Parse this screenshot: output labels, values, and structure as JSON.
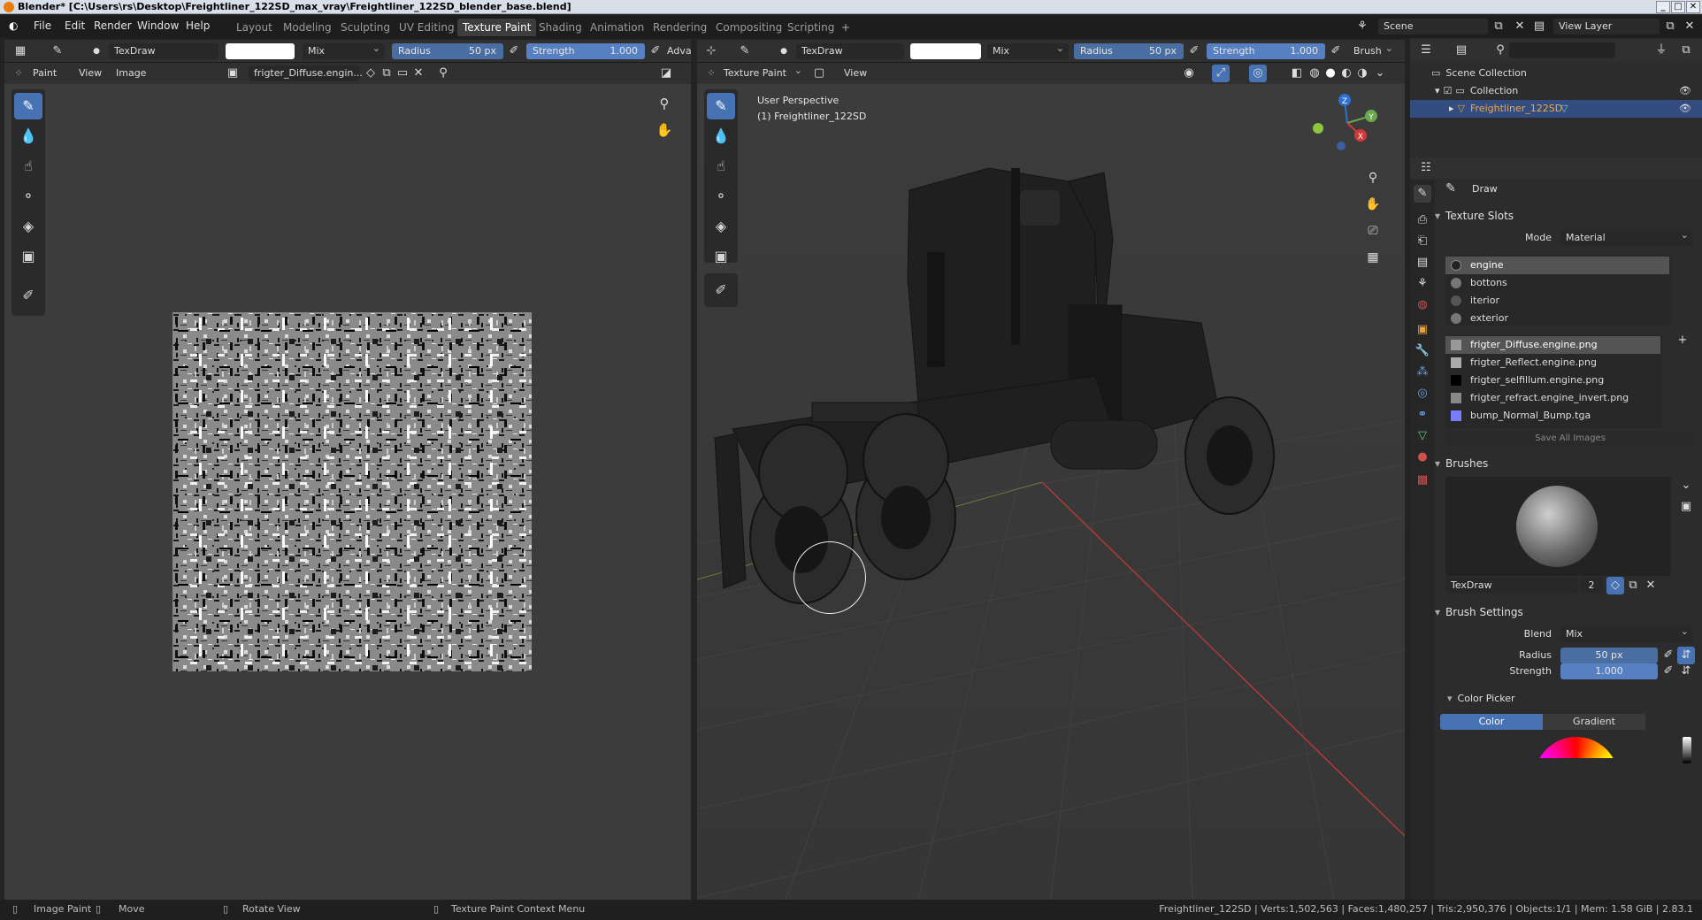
{
  "title": "Blender* [C:\\Users\\rs\\Desktop\\Freightliner_122SD_max_vray\\Freightliner_122SD_blender_base.blend]",
  "menu": [
    "File",
    "Edit",
    "Render",
    "Window",
    "Help"
  ],
  "workspaces": [
    "Layout",
    "Modeling",
    "Sculpting",
    "UV Editing",
    "Texture Paint",
    "Shading",
    "Animation",
    "Rendering",
    "Compositing",
    "Scripting"
  ],
  "active_workspace": "Texture Paint",
  "scene": "Scene",
  "view_layer": "View Layer",
  "left_header": {
    "brush": "TexDraw",
    "blend": "Mix",
    "radius_label": "Radius",
    "radius_value": "50 px",
    "strength_label": "Strength",
    "strength_value": "1.000",
    "adv": "Adva"
  },
  "left_sub": {
    "mode": "Paint",
    "view": "View",
    "image": "Image",
    "image_name": "frigter_Diffuse.engin..."
  },
  "right_header": {
    "brush": "TexDraw",
    "blend": "Mix",
    "radius_label": "Radius",
    "radius_value": "50 px",
    "strength_label": "Strength",
    "strength_value": "1.000",
    "brush_menu": "Brush"
  },
  "viewport": {
    "mode": "Texture Paint",
    "view": "View",
    "perspective": "User Perspective",
    "object": "(1) Freightliner_122SD",
    "gizmo": {
      "z": "Z",
      "y": "Y",
      "x": "X"
    }
  },
  "outliner": {
    "scene_collection": "Scene Collection",
    "collection": "Collection",
    "object": "Freightliner_122SD"
  },
  "properties": {
    "tool": "Draw",
    "texture_slots": "Texture Slots",
    "mode_label": "Mode",
    "mode_value": "Material",
    "materials": [
      "engine",
      "bottons",
      "iterior",
      "exterior"
    ],
    "images": [
      "frigter_Diffuse.engine.png",
      "frigter_Reflect.engine.png",
      "frigter_selfillum.engine.png",
      "frigter_refract.engine_invert.png",
      "bump_Normal_Bump.tga"
    ],
    "save_all": "Save All Images",
    "brushes": "Brushes",
    "brush_name": "TexDraw",
    "brush_users": "2",
    "brush_settings": "Brush Settings",
    "blend_label": "Blend",
    "blend_value": "Mix",
    "radius_label": "Radius",
    "radius_value": "50 px",
    "strength_label": "Strength",
    "strength_value": "1.000",
    "color_picker": "Color Picker",
    "color_tab": "Color",
    "gradient_tab": "Gradient"
  },
  "status": {
    "image_paint": "Image Paint",
    "move": "Move",
    "rotate": "Rotate View",
    "context": "Texture Paint Context Menu",
    "stats": "Freightliner_122SD | Verts:1,502,563 | Faces:1,480,257 | Tris:2,950,376 | Objects:1/1 | Mem: 1.58 GiB | 2.83.1"
  }
}
